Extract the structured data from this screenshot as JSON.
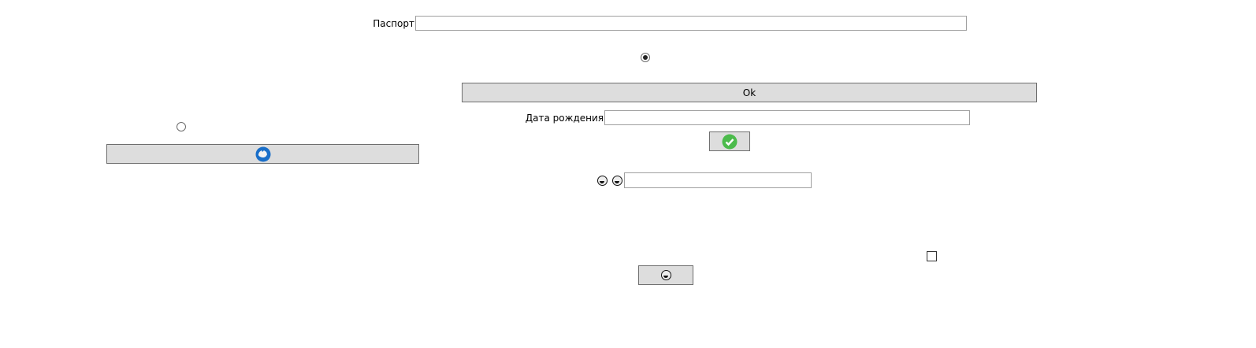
{
  "passport": {
    "label": "Паспорт",
    "value": ""
  },
  "ok_button": {
    "label": "Ok"
  },
  "birth_date": {
    "label": "Дата рождения",
    "value": ""
  },
  "radios": {
    "top_checked": true,
    "left_checked": false
  },
  "checkbox": {
    "checked": false
  },
  "icons": {
    "refresh_button": "blue-refresh-icon",
    "confirm_button": "green-check-icon",
    "emoji_button": "laughing-emoji-icon",
    "emoji_1": "laughing-emoji-icon",
    "emoji_2": "grinning-emoji-icon"
  },
  "colors": {
    "button_bg": "#dddddd",
    "check_green": "#4cbb4c",
    "refresh_blue": "#1a6fc9"
  },
  "emoji_field": {
    "value": ""
  }
}
